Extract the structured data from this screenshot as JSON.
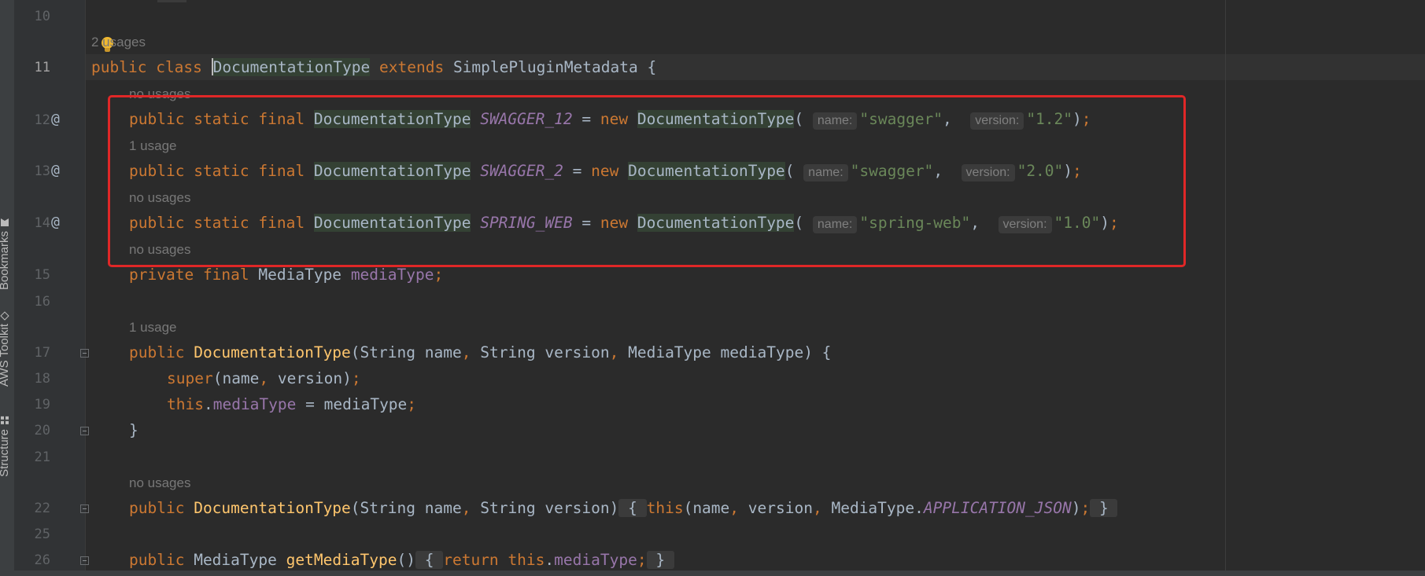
{
  "sidebar": {
    "tabs": [
      {
        "label": "Bookmarks",
        "icon": "bookmark-icon"
      },
      {
        "label": "AWS Toolkit",
        "icon": "aws-cube-icon"
      },
      {
        "label": "Structure",
        "icon": "structure-icon"
      }
    ]
  },
  "editor": {
    "line_numbers": [
      "10",
      "11",
      "12",
      "13",
      "14",
      "15",
      "16",
      "17",
      "18",
      "19",
      "20",
      "21",
      "22",
      "25",
      "26"
    ],
    "current_line": "11",
    "usages": {
      "class": "2 usages",
      "swagger_12": "no usages",
      "swagger_2": "1 usage",
      "spring_web": "no usages",
      "media_type_field": "no usages",
      "ctor_three_arg": "1 usage",
      "ctor_two_arg": "no usages"
    },
    "hints": {
      "name": "name:",
      "version": "version:"
    },
    "tokens": {
      "public": "public",
      "class": "class",
      "static": "static",
      "final": "final",
      "private": "private",
      "extends": "extends",
      "new": "new",
      "super": "super",
      "this": "this",
      "return": "return",
      "class_name": "DocumentationType",
      "parent_class": "SimplePluginMetadata",
      "media_type_class": "MediaType",
      "string_class": "String",
      "swagger_12": "SWAGGER_12",
      "swagger_2": "SWAGGER_2",
      "spring_web": "SPRING_WEB",
      "media_type_field": "mediaType",
      "name_param": "name",
      "version_param": "version",
      "str_swagger": "\"swagger\"",
      "str_spring_web": "\"spring-web\"",
      "str_v12": "\"1.2\"",
      "str_v20": "\"2.0\"",
      "str_v10": "\"1.0\"",
      "app_json": "APPLICATION_JSON",
      "getter": "getMediaType"
    }
  },
  "colors": {
    "background": "#2b2b2b",
    "keyword": "#cc7832",
    "string": "#6a8759",
    "field": "#9876aa",
    "method": "#ffc66d",
    "highlight_box": "#e02727"
  }
}
